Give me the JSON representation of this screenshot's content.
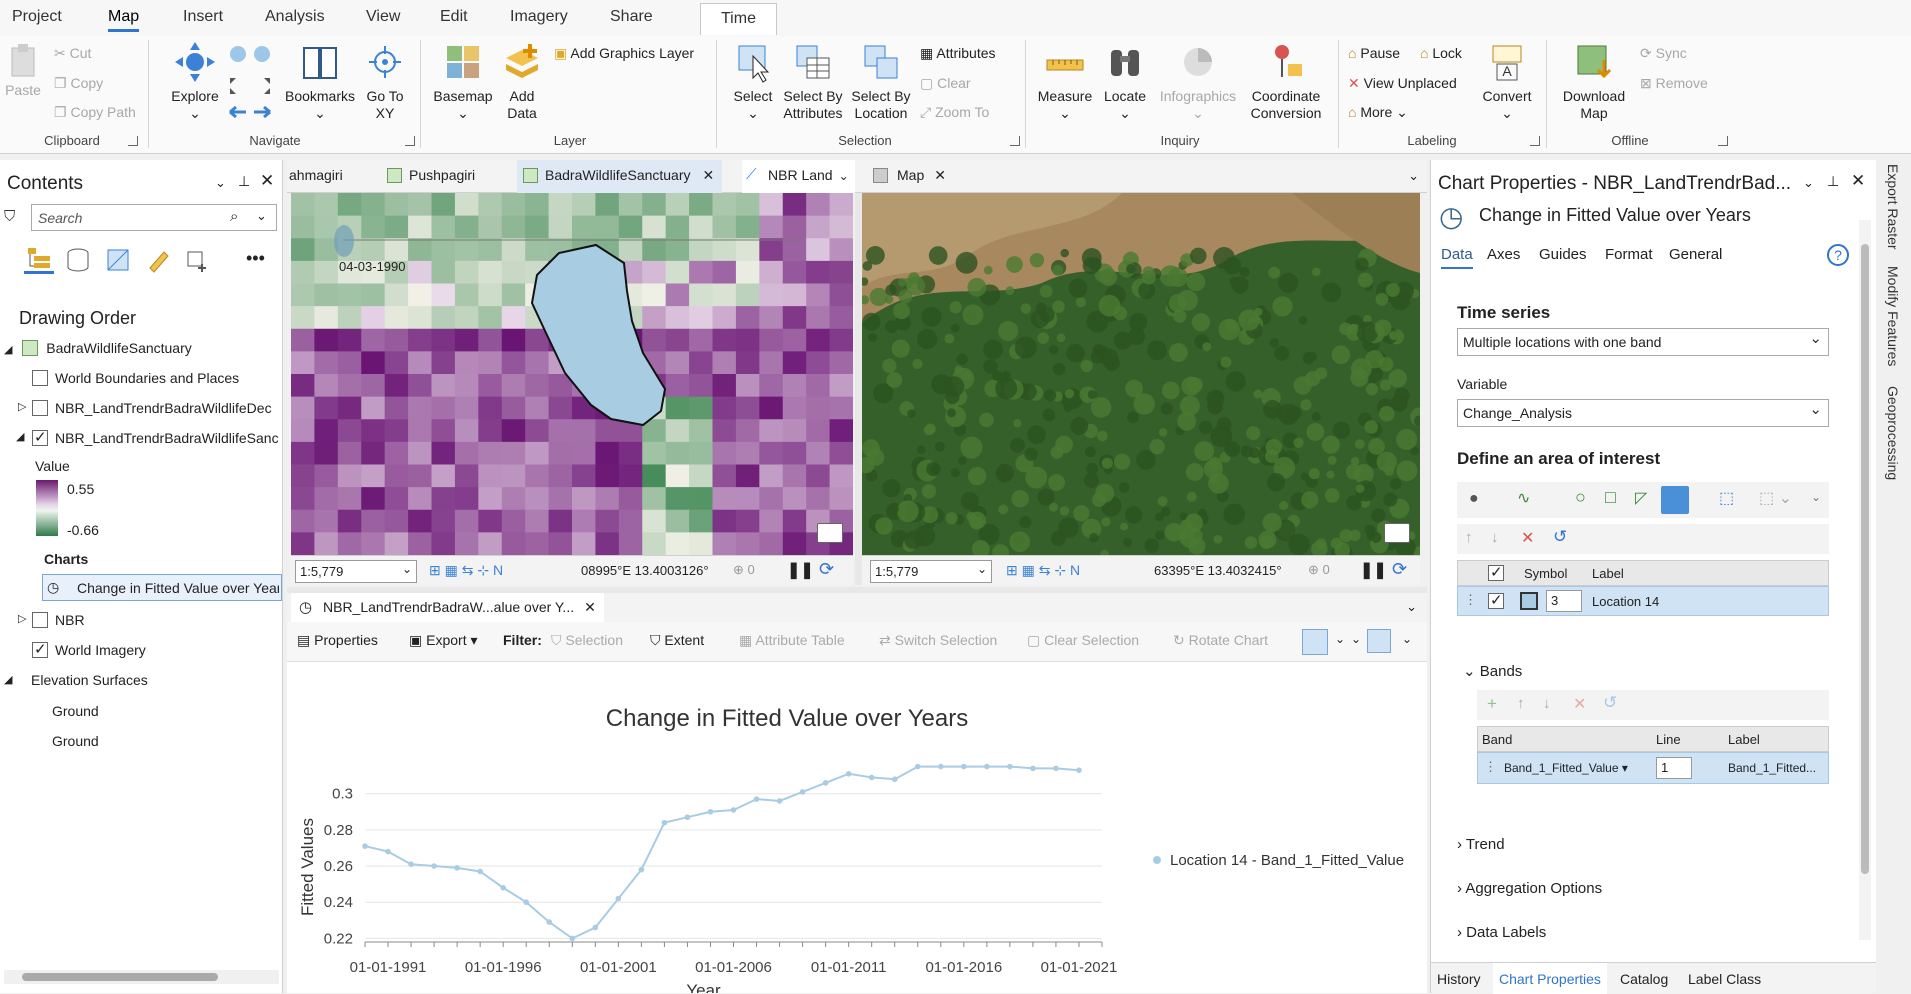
{
  "ribbon_tabs": [
    "Project",
    "Map",
    "Insert",
    "Analysis",
    "View",
    "Edit",
    "Imagery",
    "Share",
    "Time"
  ],
  "active_tab": "Map",
  "ribbon": {
    "clipboard": {
      "paste": "Paste",
      "cut": "Cut",
      "copy": "Copy",
      "copy_path": "Copy Path",
      "label": "Clipboard"
    },
    "navigate": {
      "explore": "Explore",
      "bookmarks": "Bookmarks",
      "go_to_xy": "Go To XY",
      "label": "Navigate"
    },
    "layer": {
      "basemap": "Basemap",
      "add_data": "Add Data",
      "add_graphics_layer": "Add Graphics Layer",
      "label": "Layer"
    },
    "selection": {
      "select": "Select",
      "select_by_attributes": "Select By Attributes",
      "select_by_location": "Select By Location",
      "attributes": "Attributes",
      "clear": "Clear",
      "zoom_to": "Zoom To",
      "label": "Selection"
    },
    "inquiry": {
      "measure": "Measure",
      "locate": "Locate",
      "infographics": "Infographics",
      "coordinate_conversion": "Coordinate Conversion",
      "label": "Inquiry"
    },
    "labeling": {
      "pause": "Pause",
      "lock": "Lock",
      "view_unplaced": "View Unplaced",
      "more": "More",
      "convert": "Convert",
      "label": "Labeling"
    },
    "offline": {
      "download_map": "Download Map",
      "sync": "Sync",
      "remove": "Remove",
      "label": "Offline"
    }
  },
  "contents": {
    "title": "Contents",
    "search_placeholder": "Search",
    "drawing_order": "Drawing Order",
    "map_name": "BadraWildlifeSanctuary",
    "layers": [
      {
        "name": "World Boundaries and Places",
        "checked": false
      },
      {
        "name": "NBR_LandTrendrBadraWildlifeDec",
        "checked": false
      },
      {
        "name": "NBR_LandTrendrBadraWildlifeSanc",
        "checked": true
      }
    ],
    "value_label": "Value",
    "value_max": "0.55",
    "value_min": "-0.66",
    "charts_label": "Charts",
    "chart_item": "Change in  Fitted Value over Years",
    "nbr": "NBR",
    "world_imagery": "World Imagery",
    "elevation_surfaces": "Elevation Surfaces",
    "ground1": "Ground",
    "ground2": "Ground"
  },
  "map_tabs": [
    "ahmagiri",
    "Pushpagiri",
    "BadraWildlifeSanctuary",
    "NBR Land",
    "Map"
  ],
  "map_left": {
    "date_label": "04-03-1990",
    "scale": "1:5,779",
    "coords": "08995°E 13.4003126°",
    "count": "0"
  },
  "map_right": {
    "scale": "1:5,779",
    "coords": "63395°E 13.4032415°",
    "count": "0"
  },
  "chart_tab": "NBR_LandTrendrBadraW...alue over Y...",
  "chart_toolbar": {
    "properties": "Properties",
    "export": "Export",
    "filter": "Filter:",
    "selection": "Selection",
    "extent": "Extent",
    "attribute_table": "Attribute Table",
    "switch_selection": "Switch Selection",
    "clear_selection": "Clear Selection",
    "rotate_chart": "Rotate Chart"
  },
  "chart_data": {
    "type": "line",
    "title": "Change in Fitted Value over Years",
    "xlabel": "Year",
    "ylabel": "Fitted Values",
    "x_tick_labels": [
      "01-01-1991",
      "01-01-1996",
      "01-01-2001",
      "01-01-2006",
      "01-01-2011",
      "01-01-2016",
      "01-01-2021"
    ],
    "y_tick_labels": [
      "0.22",
      "0.24",
      "0.26",
      "0.28",
      "0.3"
    ],
    "ylim": [
      0.218,
      0.312
    ],
    "x_years": [
      1990,
      1991,
      1992,
      1993,
      1994,
      1995,
      1996,
      1997,
      1998,
      1999,
      2000,
      2001,
      2002,
      2003,
      2004,
      2005,
      2006,
      2007,
      2008,
      2009,
      2010,
      2011,
      2012,
      2013,
      2014,
      2015,
      2016,
      2017,
      2018,
      2019,
      2020,
      2021
    ],
    "series": [
      {
        "name": "Location 14 - Band_1_Fitted_Value",
        "color": "#a8cde3",
        "values": [
          0.271,
          0.268,
          0.261,
          0.26,
          0.259,
          0.257,
          0.248,
          0.24,
          0.229,
          0.22,
          0.226,
          0.242,
          0.258,
          0.284,
          0.287,
          0.29,
          0.291,
          0.297,
          0.296,
          0.301,
          0.306,
          0.311,
          0.309,
          0.308,
          0.315,
          0.315,
          0.315,
          0.315,
          0.315,
          0.314,
          0.314,
          0.313
        ]
      }
    ],
    "legend_position": "right"
  },
  "chart_properties": {
    "title": "Chart Properties - NBR_LandTrendrBad...",
    "chart_name": "Change in  Fitted Value over Years",
    "tabs": [
      "Data",
      "Axes",
      "Guides",
      "Format",
      "General"
    ],
    "active_tab": "Data",
    "time_series_label": "Time series",
    "time_series_value": "Multiple locations with one band",
    "variable_label": "Variable",
    "variable_value": "Change_Analysis",
    "aoi_label": "Define an area of interest",
    "symbol_header": "Symbol",
    "label_header": "Label",
    "location_symbol_value": "3",
    "location_label": "Location 14",
    "bands_label": "Bands",
    "band_header": "Band",
    "line_header": "Line",
    "band_label_header": "Label",
    "band_value": "Band_1_Fitted_Value",
    "line_value": "1",
    "band_label_value": "Band_1_Fitted...",
    "trend": "Trend",
    "aggregation": "Aggregation Options",
    "data_labels": "Data Labels"
  },
  "bottom_tabs": [
    "History",
    "Chart Properties",
    "Catalog",
    "Label Class"
  ],
  "active_bottom_tab": "Chart Properties",
  "side_tabs": [
    "Export Raster",
    "Modify Features",
    "Geoprocessing"
  ]
}
